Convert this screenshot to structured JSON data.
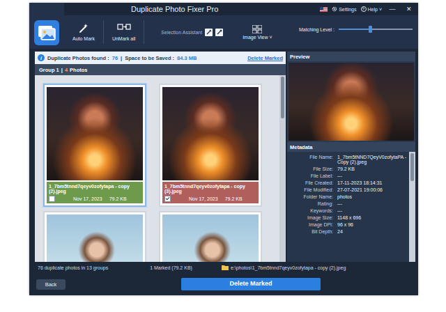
{
  "window": {
    "title": "Duplicate Photo Fixer Pro",
    "controls": [
      "—",
      "✕"
    ]
  },
  "menu": {
    "settings": "Settings",
    "help_icon": "?",
    "help": "Help",
    "help_caret": "˅"
  },
  "toolbar": {
    "auto_mark": "Auto Mark",
    "unmark_all": "UnMark all",
    "selection_assistant": "Selection Assistant",
    "image_view": "Image View",
    "image_view_caret": "˅",
    "matching_label": "Matching Level :",
    "matching_level": 0.42
  },
  "summary": {
    "info_icon": "i",
    "found_label": "Duplicate Photos found :",
    "found": "76",
    "divider": "|",
    "space_label": "Space to be Saved :",
    "space": "84.3 MB",
    "delete_link": "Delete Marked"
  },
  "group": {
    "title": "Group 1",
    "divider": "|",
    "count": "4",
    "unit": "Photos"
  },
  "photos": [
    {
      "kind": "captioned",
      "name": "1_7bm5tnnd7qeyv0zofytapa - copy (2).jpeg",
      "date": "Nov 17, 2023",
      "size": "79.2 KB",
      "checked": false,
      "selected": true,
      "color": "#6e9a4c"
    },
    {
      "kind": "captioned",
      "name": "1_7bm5tnnd7qeyv0zofytapa - copy (3).jpeg",
      "date": "Nov 17, 2023",
      "size": "79.2 KB",
      "checked": true,
      "selected": false,
      "color": "#b0605c"
    },
    {
      "kind": "partial",
      "selected": false
    },
    {
      "kind": "partial",
      "selected": false
    }
  ],
  "preview": {
    "title": "Preview"
  },
  "metadata": {
    "title": "Metadata",
    "rows": [
      {
        "label": "File Name:",
        "value": "1_7bm5tNND7QeyV0zofytaPA - Copy (2).jpeg"
      },
      {
        "label": "File Size:",
        "value": "79.2 KB"
      },
      {
        "label": "File Label:",
        "value": "---"
      },
      {
        "label": "File Created:",
        "value": "17-11-2023 18:14:31"
      },
      {
        "label": "File Modified:",
        "value": "27-07-2021 19:00:06"
      },
      {
        "label": "Folder Name:",
        "value": "photos"
      },
      {
        "label": "Rating:",
        "value": "---"
      },
      {
        "label": "Keywords:",
        "value": "---"
      },
      {
        "label": "Image Size:",
        "value": "1148 x 696"
      },
      {
        "label": "Image DPI:",
        "value": "96 x 96"
      },
      {
        "label": "Bit Depth:",
        "value": "24"
      }
    ]
  },
  "status_bar": {
    "summary": "76 duplicate photos in 13 groups",
    "marked": "1 Marked (79.2 KB)",
    "path": "e:\\photos\\1_7bm5tnnd7qeyv0zofytapa - copy (2).jpeg"
  },
  "buttons": {
    "back": "Back",
    "delete": "Delete Marked"
  }
}
